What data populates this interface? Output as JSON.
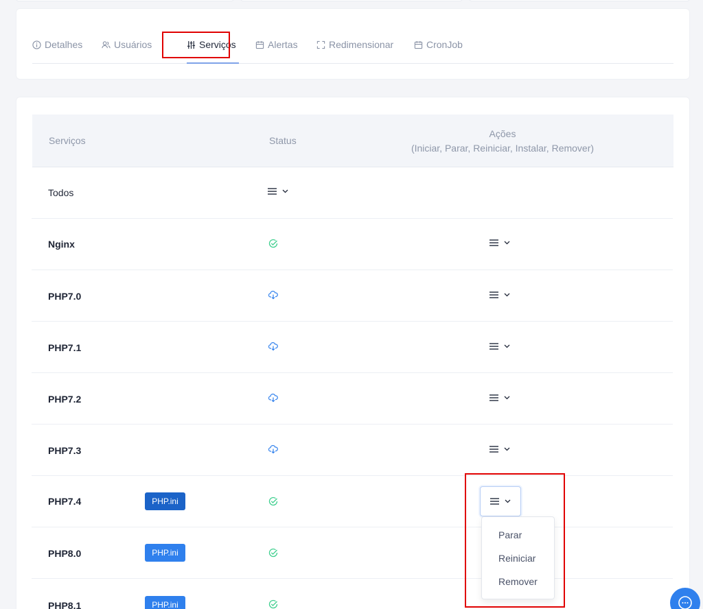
{
  "tabs": [
    {
      "label": "Detalhes",
      "icon": "info-icon"
    },
    {
      "label": "Usuários",
      "icon": "users-icon"
    },
    {
      "label": "Serviços",
      "icon": "sliders-icon"
    },
    {
      "label": "Alertas",
      "icon": "calendar-icon"
    },
    {
      "label": "Redimensionar",
      "icon": "expand-icon"
    },
    {
      "label": "CronJob",
      "icon": "calendar-icon"
    }
  ],
  "active_tab": "Serviços",
  "table": {
    "headers": {
      "services": "Serviços",
      "status": "Status",
      "actions_title": "Ações",
      "actions_subtitle": "(Iniciar, Parar, Reiniciar, Instalar, Remover)"
    },
    "rows": [
      {
        "name": "Todos",
        "badge": "",
        "status": "",
        "has_action": false
      },
      {
        "name": "Nginx",
        "badge": "",
        "status": "running",
        "has_action": true
      },
      {
        "name": "PHP7.0",
        "badge": "",
        "status": "install",
        "has_action": true
      },
      {
        "name": "PHP7.1",
        "badge": "",
        "status": "install",
        "has_action": true
      },
      {
        "name": "PHP7.2",
        "badge": "",
        "status": "install",
        "has_action": true
      },
      {
        "name": "PHP7.3",
        "badge": "",
        "status": "install",
        "has_action": true
      },
      {
        "name": "PHP7.4",
        "badge": "PHP.ini",
        "status": "running",
        "has_action": true
      },
      {
        "name": "PHP8.0",
        "badge": "PHP.ini",
        "status": "running",
        "has_action": true
      },
      {
        "name": "PHP8.1",
        "badge": "PHP.ini",
        "status": "running",
        "has_action": true
      }
    ]
  },
  "dropdown": {
    "items": [
      "Parar",
      "Reiniciar",
      "Remover"
    ]
  },
  "colors": {
    "accent": "#2f80ed",
    "success": "#3ecf8e",
    "highlight": "#e00000",
    "muted": "#8a93a6"
  }
}
